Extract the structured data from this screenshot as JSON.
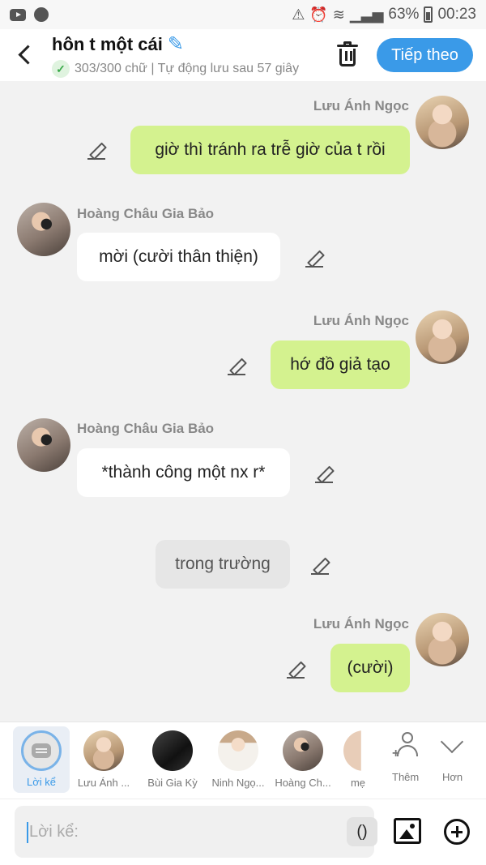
{
  "status_bar": {
    "battery": "63%",
    "time": "00:23"
  },
  "header": {
    "title": "hôn t một cái",
    "status": "303/300 chữ | Tự động lưu sau 57 giây",
    "next_button": "Tiếp theo"
  },
  "messages": [
    {
      "author": "Lưu Ánh Ngọc",
      "text": "giờ thì tránh ra trễ giờ của t rồi",
      "side": "right"
    },
    {
      "author": "Hoàng Châu Gia Bảo",
      "text": "mời (cười thân thiện)",
      "side": "left"
    },
    {
      "author": "Lưu Ánh Ngọc",
      "text": "hớ đồ giả tạo",
      "side": "right"
    },
    {
      "author": "Hoàng Châu Gia Bảo",
      "text": "*thành công một nx r*",
      "side": "left"
    },
    {
      "author": "",
      "text": "trong trường",
      "side": "narration"
    },
    {
      "author": "Lưu Ánh Ngọc",
      "text": "(cười)",
      "side": "right"
    }
  ],
  "characters": [
    {
      "label": "Lời kể"
    },
    {
      "label": "Lưu Ánh ..."
    },
    {
      "label": "Bùi Gia Kỳ"
    },
    {
      "label": "Ninh Ngọ..."
    },
    {
      "label": "Hoàng Ch..."
    },
    {
      "label": "mẹ"
    }
  ],
  "char_actions": {
    "add": "Thêm",
    "more": "Hơn"
  },
  "input": {
    "placeholder": "Lời kể:",
    "paren": "()"
  },
  "colors": {
    "accent": "#3a9ae8",
    "my_bubble": "#d4f28f"
  }
}
